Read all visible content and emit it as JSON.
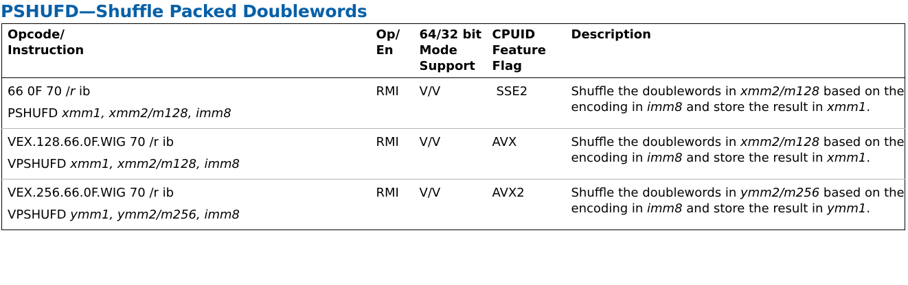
{
  "title": "PSHUFD—Shuffle Packed Doublewords",
  "headers": {
    "opcode_line1": "Opcode/",
    "opcode_line2": "Instruction",
    "open_line1": "Op/",
    "open_line2": "En",
    "mode_line1": "64/32 bit",
    "mode_line2": "Mode",
    "mode_line3": "Support",
    "cpuid_line1": "CPUID",
    "cpuid_line2": "Feature",
    "cpuid_line3": "Flag",
    "description": "Description"
  },
  "rows": [
    {
      "opcode_pre": "66 0F 70 /",
      "opcode_r": "r",
      "opcode_post": " ib",
      "instr_name": "PSHUFD ",
      "instr_operands": "xmm1, xmm2/m128, imm8",
      "op_en": "RMI",
      "mode": "V/V",
      "cpuid": "SSE2",
      "desc_a": "Shuffle the doublewords in ",
      "desc_b": "xmm2/m128",
      "desc_c": " based on the encoding in ",
      "desc_d": "imm8",
      "desc_e": " and store the result in ",
      "desc_f": "xmm1",
      "desc_g": "."
    },
    {
      "opcode_pre": "VEX.128.66.0F.WIG 70 /r ib",
      "opcode_r": "",
      "opcode_post": "",
      "instr_name": "VPSHUFD ",
      "instr_operands": "xmm1, xmm2/m128, imm8",
      "op_en": "RMI",
      "mode": "V/V",
      "cpuid": "AVX",
      "desc_a": "Shuffle the doublewords in ",
      "desc_b": "xmm2/m128",
      "desc_c": " based on the encoding in ",
      "desc_d": "imm8",
      "desc_e": " and store the result in ",
      "desc_f": "xmm1",
      "desc_g": "."
    },
    {
      "opcode_pre": "VEX.256.66.0F.WIG 70 /r ib",
      "opcode_r": "",
      "opcode_post": "",
      "instr_name": "VPSHUFD ",
      "instr_operands": "ymm1, ymm2/m256, imm8",
      "op_en": "RMI",
      "mode": "V/V",
      "cpuid": "AVX2",
      "desc_a": "Shuffle the doublewords in ",
      "desc_b": "ymm2/m256",
      "desc_c": " based on the encoding in ",
      "desc_d": "imm8",
      "desc_e": " and store the result in ",
      "desc_f": "ymm1",
      "desc_g": "."
    }
  ]
}
